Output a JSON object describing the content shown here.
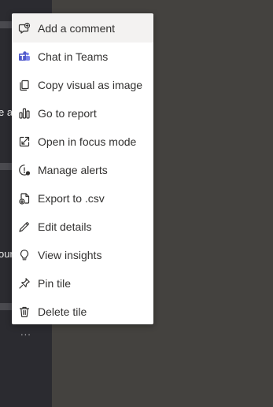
{
  "sidebar": {
    "text_fragments": [
      "e a",
      "our"
    ],
    "more_label": "..."
  },
  "menu": {
    "items": [
      {
        "label": "Add a comment",
        "icon": "comment-icon"
      },
      {
        "label": "Chat in Teams",
        "icon": "teams-icon"
      },
      {
        "label": "Copy visual as image",
        "icon": "copy-icon"
      },
      {
        "label": "Go to report",
        "icon": "bar-chart-icon"
      },
      {
        "label": "Open in focus mode",
        "icon": "focus-mode-icon"
      },
      {
        "label": "Manage alerts",
        "icon": "alert-icon"
      },
      {
        "label": "Export to .csv",
        "icon": "export-icon"
      },
      {
        "label": "Edit details",
        "icon": "pencil-icon"
      },
      {
        "label": "View insights",
        "icon": "lightbulb-icon"
      },
      {
        "label": "Pin tile",
        "icon": "pin-icon"
      },
      {
        "label": "Delete tile",
        "icon": "trash-icon"
      }
    ]
  },
  "colors": {
    "background": "#44423f",
    "left_panel": "#2b2b30",
    "menu_background": "#ffffff",
    "menu_hover": "#f3f2f1",
    "teams_purple": "#5059c9",
    "text": "#323130"
  }
}
